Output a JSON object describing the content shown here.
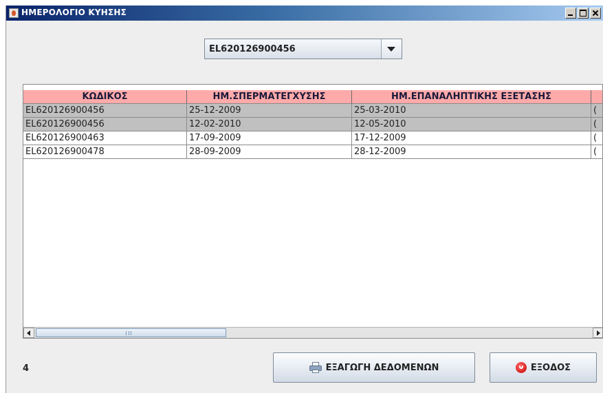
{
  "window": {
    "title": "ΗΜΕΡΟΛΟΓΙΟ ΚΥΗΣΗΣ"
  },
  "combo": {
    "selected": "EL620126900456"
  },
  "table": {
    "columns": [
      "ΚΩΔΙΚΟΣ",
      "ΗΜ.ΣΠΕΡΜΑΤΕΓΧΥΣΗΣ",
      "ΗΜ.ΕΠΑΝΑΛΗΠΤΙΚΗΣ ΕΞΕΤΑΣΗΣ",
      ""
    ],
    "rows": [
      [
        "EL620126900456",
        "25-12-2009",
        "25-03-2010",
        "("
      ],
      [
        "EL620126900456",
        "12-02-2010",
        "12-05-2010",
        "("
      ],
      [
        "EL620126900463",
        "17-09-2009",
        "17-12-2009",
        "("
      ],
      [
        "EL620126900478",
        "28-09-2009",
        "28-12-2009",
        "("
      ]
    ],
    "selected_rows": [
      0,
      1
    ]
  },
  "footer": {
    "record_count": "4",
    "export_label": "ΕΞΑΓΩΓΗ ΔΕΔΟΜΕΝΩΝ",
    "exit_label": "ΕΞΟΔΟΣ"
  },
  "icons": {
    "app": "java-cup-icon",
    "export": "printer-icon",
    "exit": "exit-icon"
  },
  "colors": {
    "header_bg": "#ffaaaa",
    "selected_row_bg": "#c0c0c0",
    "titlebar": "#0a246a"
  }
}
